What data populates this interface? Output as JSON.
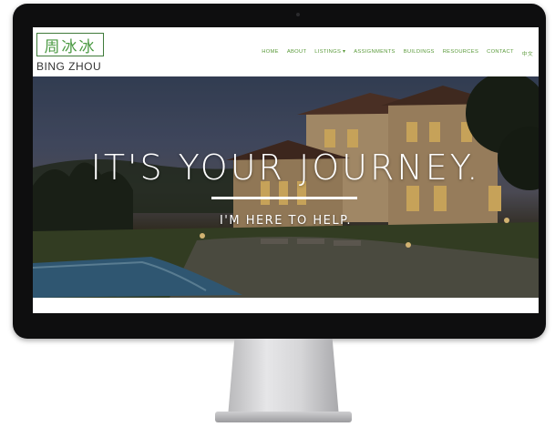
{
  "header": {
    "logo_chinese": "周冰冰",
    "logo_name": "BING ZHOU",
    "nav": [
      {
        "label": "HOME"
      },
      {
        "label": "ABOUT"
      },
      {
        "label": "LISTINGS ▾"
      },
      {
        "label": "ASSIGNMENTS"
      },
      {
        "label": "BUILDINGS"
      },
      {
        "label": "RESOURCES"
      },
      {
        "label": "CONTACT"
      },
      {
        "label": "中文"
      }
    ]
  },
  "hero": {
    "title": "IT'S YOUR JOURNEY.",
    "subtitle": "I'M HERE TO HELP."
  },
  "colors": {
    "brand_green": "#4b9a43",
    "nav_green": "#5a9a3a",
    "monitor_bezel": "#0e0e0f"
  }
}
